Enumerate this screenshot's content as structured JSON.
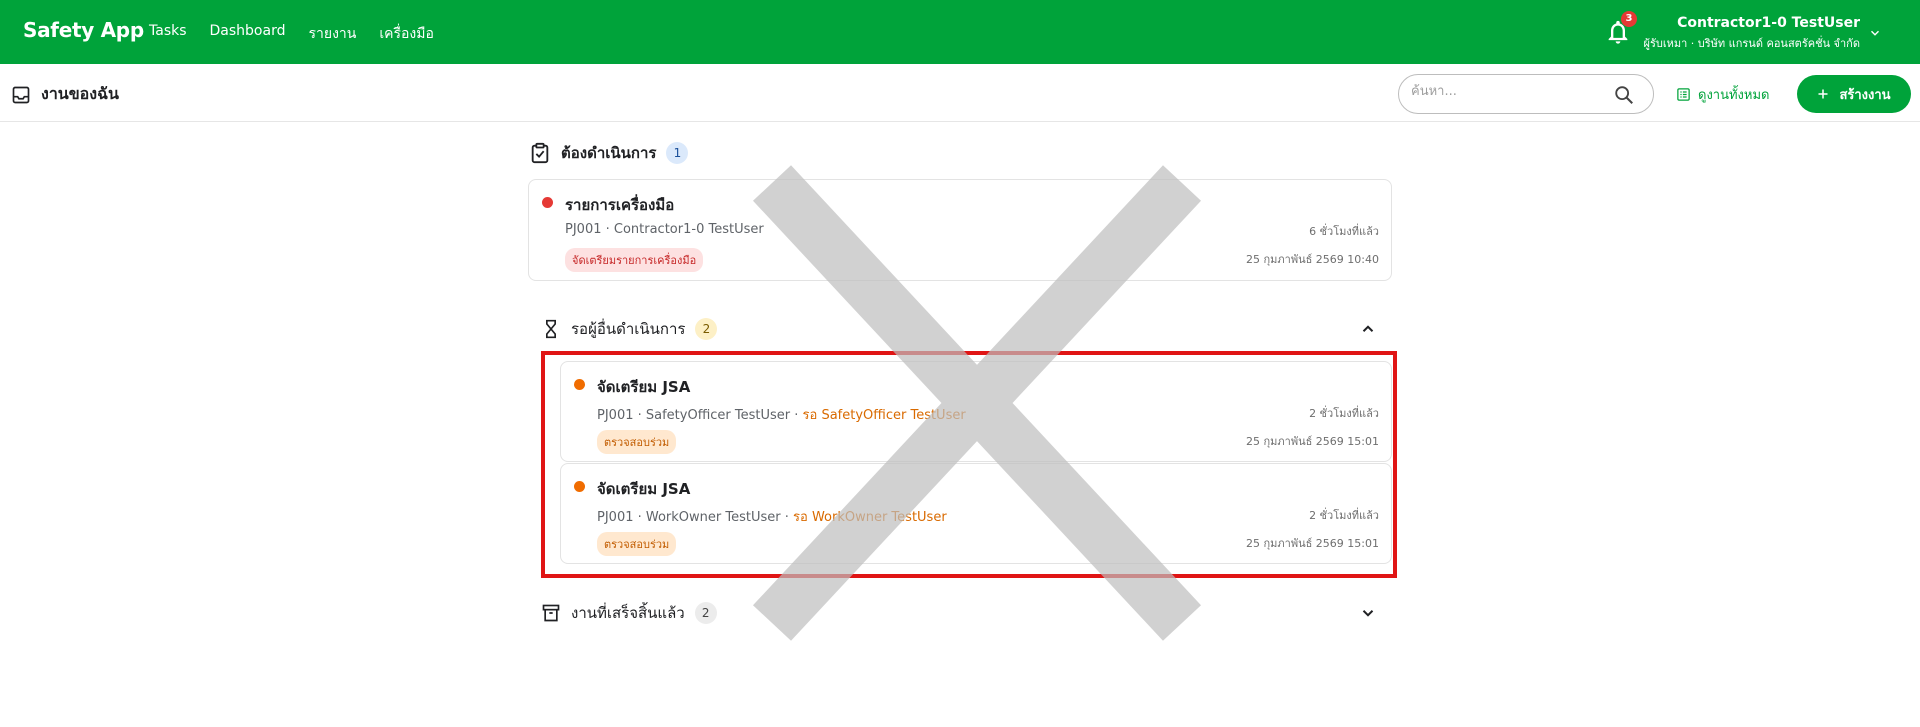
{
  "app": {
    "brand": "Safety App",
    "nav": [
      "Tasks",
      "Dashboard",
      "รายงาน",
      "เครื่องมือ"
    ],
    "notification_count": "3",
    "user_name": "Contractor1-0 TestUser",
    "user_org": "ผู้รับเหมา · บริษัท แกรนด์ คอนสตรัคชั่น จำกัด"
  },
  "page": {
    "title": "งานของฉัน",
    "search_placeholder": "ค้นหา...",
    "view_all_label": "ดูงานทั้งหมด",
    "create_label": "สร้างงาน"
  },
  "sections": {
    "todo": {
      "label": "ต้องดำเนินการ",
      "count": "1",
      "items": [
        {
          "title": "รายการเครื่องมือ",
          "meta": "PJ001 · Contractor1-0 TestUser",
          "chip": "จัดเตรียมรายการเครื่องมือ",
          "relative_time": "6 ชั่วโมงที่แล้ว",
          "datetime": "25 กุมภาพันธ์ 2569 10:40",
          "dot_color": "#e53935"
        }
      ]
    },
    "waiting": {
      "label": "รอผู้อื่นดำเนินการ",
      "count": "2",
      "items": [
        {
          "title": "จัดเตรียม JSA",
          "meta": "PJ001 · SafetyOfficer TestUser · ",
          "waiting_for": "รอ SafetyOfficer TestUser",
          "chip": "ตรวจสอบร่วม",
          "relative_time": "2 ชั่วโมงที่แล้ว",
          "datetime": "25 กุมภาพันธ์ 2569 15:01",
          "dot_color": "#f06c00"
        },
        {
          "title": "จัดเตรียม JSA",
          "meta": "PJ001 · WorkOwner TestUser · ",
          "waiting_for": "รอ WorkOwner TestUser",
          "chip": "ตรวจสอบร่วม",
          "relative_time": "2 ชั่วโมงที่แล้ว",
          "datetime": "25 กุมภาพันธ์ 2569 15:01",
          "dot_color": "#f06c00"
        }
      ]
    },
    "done": {
      "label": "งานที่เสร็จสิ้นแล้ว",
      "count": "2"
    }
  },
  "colors": {
    "brand_green": "#00a33a",
    "highlight_red": "#e01515",
    "overlay_gray": "#cfcfcf"
  },
  "icons": [
    "bell-icon",
    "chevron-down-icon",
    "inbox-icon",
    "search-icon",
    "list-icon",
    "plus-icon",
    "clipboard-check-icon",
    "hourglass-icon",
    "archive-icon",
    "chevron-up-icon"
  ]
}
